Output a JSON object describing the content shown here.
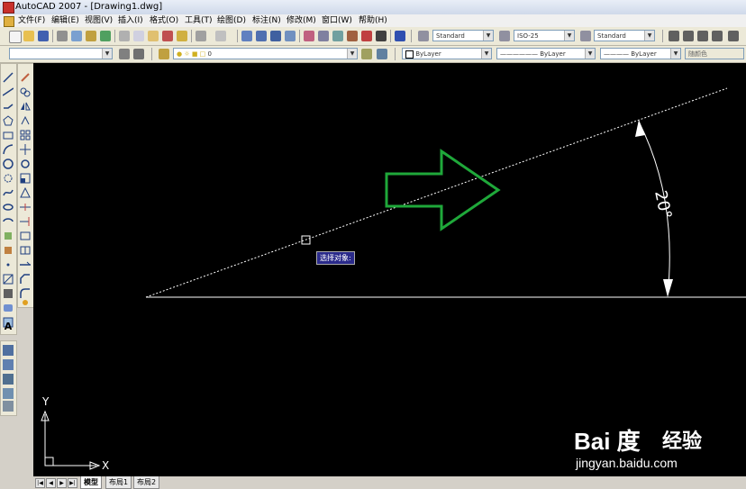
{
  "window": {
    "title": "AutoCAD 2007 - [Drawing1.dwg]"
  },
  "menu": {
    "items": [
      {
        "label": "文件(F)"
      },
      {
        "label": "编辑(E)"
      },
      {
        "label": "视图(V)"
      },
      {
        "label": "插入(I)"
      },
      {
        "label": "格式(O)"
      },
      {
        "label": "工具(T)"
      },
      {
        "label": "绘图(D)"
      },
      {
        "label": "标注(N)"
      },
      {
        "label": "修改(M)"
      },
      {
        "label": "窗口(W)"
      },
      {
        "label": "帮助(H)"
      }
    ]
  },
  "toolbar": {
    "text_style": "Standard",
    "dim_style": "ISO-25",
    "table_style": "Standard",
    "layer_value": "0",
    "color": "ByLayer",
    "linetype": "ByLayer",
    "lineweight": "ByLayer",
    "plot_style": "随颜色"
  },
  "drawing": {
    "angle_label": "20°",
    "tooltip": "选择对象:",
    "ucs_x": "X",
    "ucs_y": "Y",
    "arrow_color": "#1fa83a",
    "line_color": "#ffffff"
  },
  "tabs": {
    "items": [
      {
        "label": "模型"
      },
      {
        "label": "布局1"
      },
      {
        "label": "布局2"
      }
    ]
  },
  "watermark": {
    "brand": "Bai 度",
    "site_cn": "经验",
    "url": "jingyan.baidu.com"
  }
}
